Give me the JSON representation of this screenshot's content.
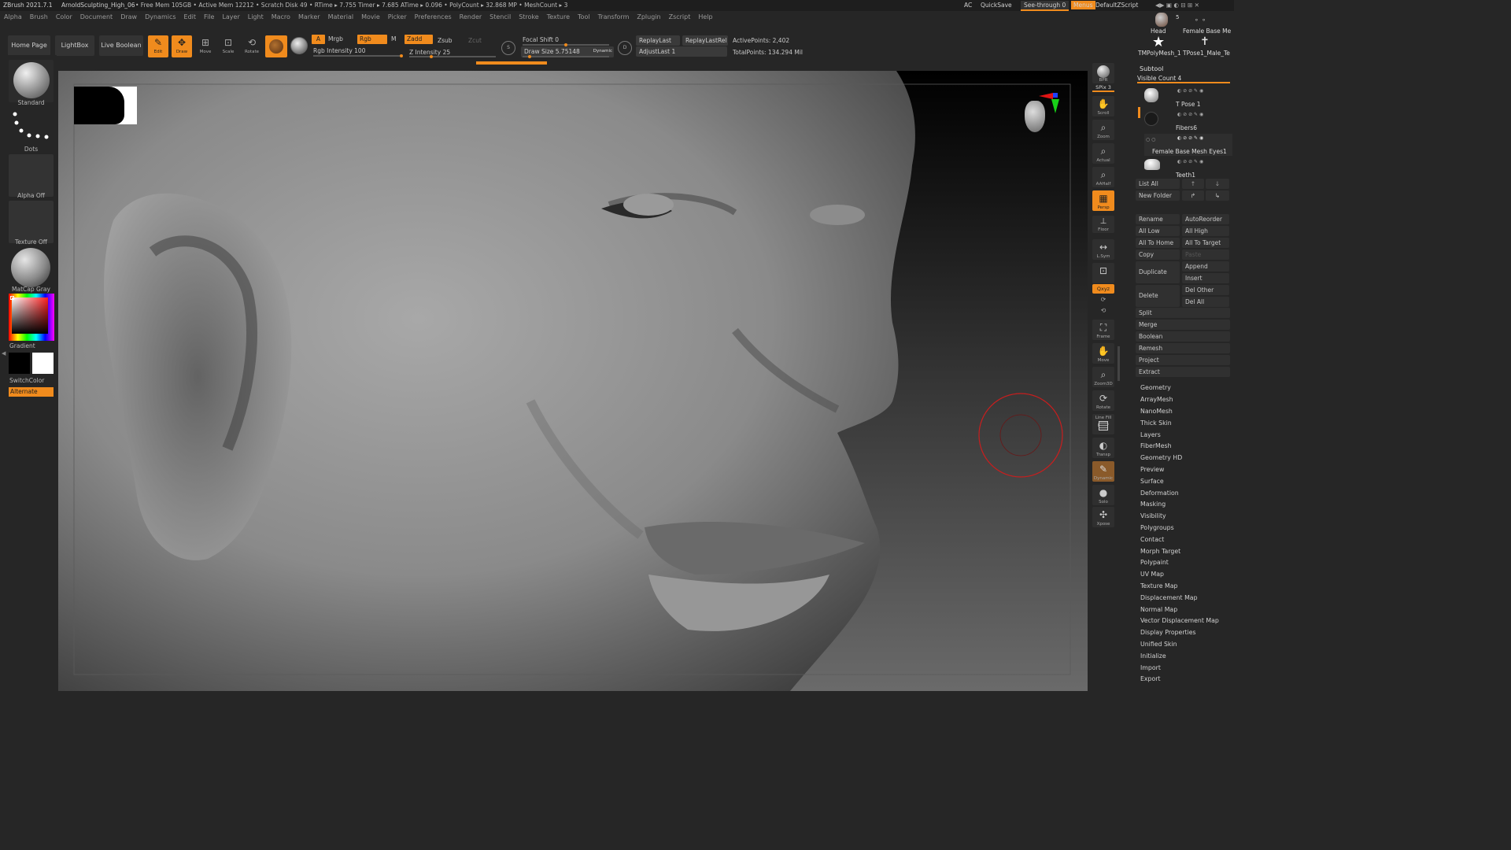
{
  "title_bar": {
    "app": "ZBrush 2021.7.1",
    "document": "ArnoldSculpting_High_06",
    "stats": "• Free Mem 105GB • Active Mem 12212 • Scratch Disk 49 • RTime ▸ 7.755 Timer ▸ 7.685 ATime ▸ 0.096 • PolyCount ▸ 32.868 MP • MeshCount ▸ 3",
    "ac": "AC",
    "quicksave": "QuickSave",
    "see_through": "See-through 0",
    "menus": "Menus",
    "default_zscript": "DefaultZScript"
  },
  "menubar": [
    "Alpha",
    "Brush",
    "Color",
    "Document",
    "Draw",
    "Dynamics",
    "Edit",
    "File",
    "Layer",
    "Light",
    "Macro",
    "Marker",
    "Material",
    "Movie",
    "Picker",
    "Preferences",
    "Render",
    "Stencil",
    "Stroke",
    "Texture",
    "Tool",
    "Transform",
    "Zplugin",
    "Zscript",
    "Help"
  ],
  "toolbar": {
    "home_page": "Home Page",
    "lightbox": "LightBox",
    "live_boolean": "Live Boolean",
    "edit": "Edit",
    "draw": "Draw",
    "move": "Move",
    "scale": "Scale",
    "rotate": "Rotate",
    "a": "A",
    "mrgb": "Mrgb",
    "rgb": "Rgb",
    "m": "M",
    "zadd": "Zadd",
    "zsub": "Zsub",
    "zcut": "Zcut",
    "rgb_intensity_label": "Rgb Intensity",
    "rgb_intensity": "100",
    "z_intensity_label": "Z Intensity",
    "z_intensity": "25",
    "focal_shift_label": "Focal Shift",
    "focal_shift": "0",
    "draw_size_label": "Draw Size",
    "draw_size": "5.75148",
    "dynamic": "Dynamic",
    "replay_last": "ReplayLast",
    "replay_last_rel": "ReplayLastRel",
    "adjust_last": "AdjustLast 1",
    "active_points": "ActivePoints: 2,402",
    "total_points": "TotalPoints: 134.294 Mil",
    "s_key": "S",
    "d_key": "D",
    "rgb_intensity_frac": 1.0,
    "z_intensity_frac": 0.25,
    "focal_shift_frac": 0.5,
    "draw_size_frac": 0.08
  },
  "left_panel": {
    "brush": "Standard",
    "stroke": "Dots",
    "alpha": "Alpha Off",
    "texture": "Texture Off",
    "material": "MatCap Gray",
    "gradient": "Gradient",
    "switch_color": "SwitchColor",
    "alternate": "Alternate"
  },
  "right_shelf": [
    "BPR",
    "SPix 3",
    "Scroll",
    "Zoom",
    "Actual",
    "AAHalf",
    "Persp",
    "Floor",
    "L.Sym",
    "",
    "Qxyz",
    "",
    "",
    "Frame",
    "Move",
    "Zoom3D",
    "Rotate",
    "Line Fill PolyF",
    "Transp",
    "Dynamic",
    "Solo",
    "Xpose"
  ],
  "tool_thumbs": {
    "head": "Head",
    "head_count": "5",
    "female_base": "Female Base Me",
    "tpolymesh": "TMPolyMesh_1",
    "tpose": "TPose1_Male_Te"
  },
  "subtool": {
    "header": "Subtool",
    "visible_count": "Visible Count 4",
    "items": [
      "T Pose 1",
      "Fibers6",
      "Female Base Mesh Eyes1",
      "Teeth1"
    ],
    "list_all": "List All",
    "new_folder": "New Folder",
    "rename": "Rename",
    "auto_reorder": "AutoReorder",
    "all_low": "All Low",
    "all_high": "All High",
    "all_to_home": "All To Home",
    "all_to_target": "All To Target",
    "copy": "Copy",
    "paste": "Paste",
    "duplicate": "Duplicate",
    "append": "Append",
    "insert": "Insert",
    "delete": "Delete",
    "del_other": "Del Other",
    "del_all": "Del All",
    "split": "Split",
    "merge": "Merge",
    "boolean": "Boolean",
    "remesh": "Remesh",
    "project": "Project",
    "extract": "Extract"
  },
  "tool_menu": [
    "Geometry",
    "ArrayMesh",
    "NanoMesh",
    "Thick Skin",
    "Layers",
    "FiberMesh",
    "Geometry HD",
    "Preview",
    "Surface",
    "Deformation",
    "Masking",
    "Visibility",
    "Polygroups",
    "Contact",
    "Morph Target",
    "Polypaint",
    "UV Map",
    "Texture Map",
    "Displacement Map",
    "Normal Map",
    "Vector Displacement Map",
    "Display Properties",
    "Unified Skin",
    "Initialize",
    "Import",
    "Export"
  ],
  "colors": {
    "accent": "#f08b1d",
    "background": "#262626",
    "viewport": "#000000",
    "brush_cursor": "#c81e1e"
  }
}
